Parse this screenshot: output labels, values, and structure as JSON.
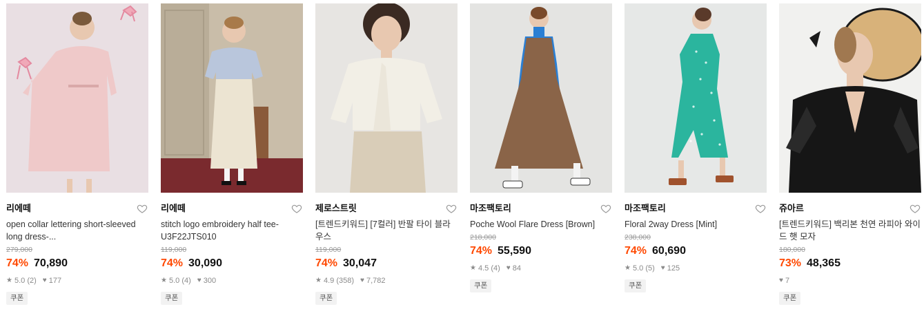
{
  "products": [
    {
      "brand": "리에떼",
      "name": "open collar lettering short-sleeved long dress-...",
      "original_price": "279,000",
      "discount": "74%",
      "price": "70,890",
      "rating": "5.0",
      "reviews": "(2)",
      "likes": "177",
      "coupon": "쿠폰",
      "colors": {
        "bg": "#e9dfe3",
        "dress": "#efc9c9",
        "skin": "#e8c8b0",
        "hair": "#7a5a3c"
      }
    },
    {
      "brand": "리에떼",
      "name": "stitch logo embroidery half tee-U3F22JTS010",
      "original_price": "119,000",
      "discount": "74%",
      "price": "30,090",
      "rating": "5.0",
      "reviews": "(4)",
      "likes": "300",
      "coupon": "쿠폰",
      "colors": {
        "bg": "#c9bda9",
        "dress": "#ece4d2",
        "top": "#b9c6dc",
        "floor": "#7a2a2e"
      }
    },
    {
      "brand": "제로스트릿",
      "name": "[트렌드키워드] [7컬러] 반팔 타이 블라우스",
      "original_price": "119,000",
      "discount": "74%",
      "price": "30,047",
      "rating": "4.9",
      "reviews": "(358)",
      "likes": "7,782",
      "coupon": "쿠폰",
      "colors": {
        "bg": "#e7e5e2",
        "top": "#f2efe6",
        "pants": "#d9cdb8",
        "hair": "#3a2a22"
      }
    },
    {
      "brand": "마조팩토리",
      "name": "Poche Wool Flare Dress [Brown]",
      "original_price": "218,000",
      "discount": "74%",
      "price": "55,590",
      "rating": "4.5",
      "reviews": "(4)",
      "likes": "84",
      "coupon": "쿠폰",
      "colors": {
        "bg": "#e4e4e2",
        "dress": "#8a6448",
        "sleeve": "#2a7fd4"
      }
    },
    {
      "brand": "마조팩토리",
      "name": "Floral 2way Dress [Mint]",
      "original_price": "238,000",
      "discount": "74%",
      "price": "60,690",
      "rating": "5.0",
      "reviews": "(5)",
      "likes": "125",
      "coupon": "쿠폰",
      "colors": {
        "bg": "#e6e8e7",
        "dress": "#2bb59e"
      }
    },
    {
      "brand": "쥬아르",
      "name": "[트렌드키워드] 백리본 천연 라피아 와이드 햇 모자",
      "original_price": "180,000",
      "discount": "73%",
      "price": "48,365",
      "rating": "",
      "reviews": "",
      "likes": "7",
      "coupon": "쿠폰",
      "colors": {
        "bg": "#f1f1ef",
        "hat": "#d8b27a",
        "dress": "#161616"
      }
    }
  ],
  "icons": {
    "star": "star-icon",
    "heart": "heart-icon",
    "like": "like-heart-icon"
  },
  "accent_color": "#ff4800"
}
